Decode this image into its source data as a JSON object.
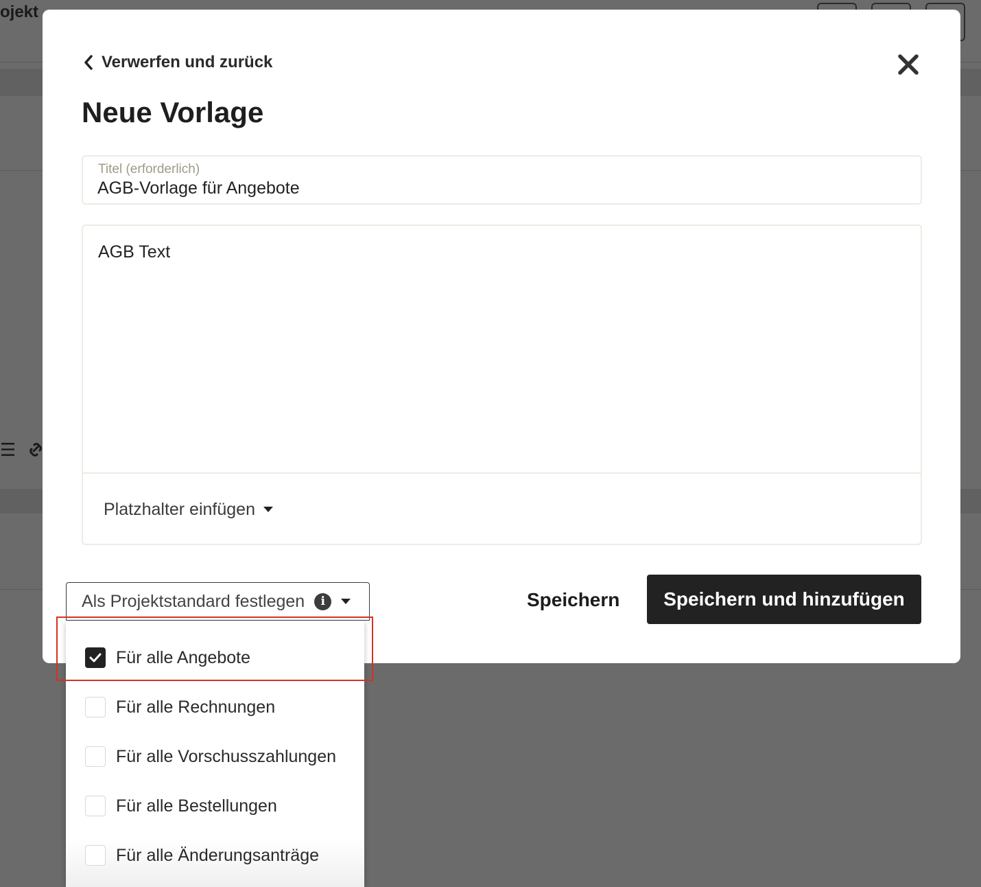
{
  "background": {
    "title": "ojekt"
  },
  "modal": {
    "back_label": "Verwerfen und zurück",
    "title": "Neue Vorlage",
    "title_field": {
      "label": "Titel (erforderlich)",
      "value": "AGB-Vorlage für Angebote"
    },
    "editor_text": "AGB Text",
    "placeholder_button": "Platzhalter einfügen",
    "default_select_label": "Als Projektstandard festlegen",
    "save_label": "Speichern",
    "save_add_label": "Speichern und hinzufügen"
  },
  "dropdown": {
    "options": [
      {
        "label": "Für alle Angebote",
        "checked": true
      },
      {
        "label": "Für alle Rechnungen",
        "checked": false
      },
      {
        "label": "Für alle Vorschusszahlungen",
        "checked": false
      },
      {
        "label": "Für alle Bestellungen",
        "checked": false
      },
      {
        "label": "Für alle Änderungsanträge",
        "checked": false
      }
    ]
  },
  "colors": {
    "overlay": "#6b6b6b",
    "primary_button": "#222222",
    "highlight": "#d5321f",
    "field_border": "#ecebe4"
  }
}
